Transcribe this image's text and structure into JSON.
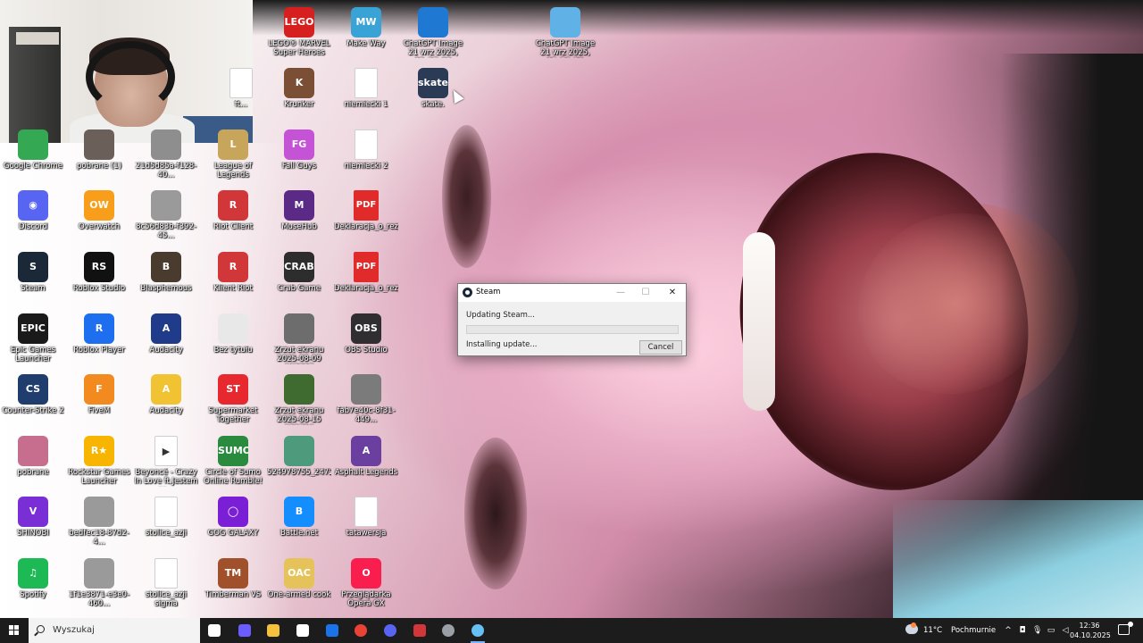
{
  "desktop": {
    "icons": [
      {
        "label": "LEGO® MARVEL Super Heroes",
        "glyph": "LEGO",
        "color": "#d6201f"
      },
      {
        "label": "Make Way",
        "glyph": "MW",
        "color": "#3aa3d6"
      },
      {
        "label": "ChatGPT Image 21 wrz 2025, 02_27_03",
        "glyph": "",
        "color": "#1f78d1"
      },
      {
        "label": "ChatGPT Image 21 wrz 2025, 05_56_20",
        "glyph": "",
        "color": "#5fb1e6"
      },
      {
        "label": "Krunker",
        "glyph": "K",
        "color": "#7a4f36"
      },
      {
        "label": "niemiecki 1",
        "glyph": "",
        "color": "#ffffff"
      },
      {
        "label": "skate.",
        "glyph": "skate",
        "color": "#2b3a55"
      },
      {
        "label": "Google Chrome",
        "glyph": "",
        "color": "#34a853"
      },
      {
        "label": "pobrane (1)",
        "glyph": "",
        "color": "#6b5f5a"
      },
      {
        "label": "21d5d85a-f128-40...",
        "glyph": "",
        "color": "#8e8e8e"
      },
      {
        "label": "League of Legends",
        "glyph": "L",
        "color": "#c7a55a"
      },
      {
        "label": "Fall Guys",
        "glyph": "FG",
        "color": "#c553d6"
      },
      {
        "label": "niemiecki 2",
        "glyph": "",
        "color": "#ffffff"
      },
      {
        "label": "Discord",
        "glyph": "◉",
        "color": "#5865f2"
      },
      {
        "label": "Overwatch",
        "glyph": "OW",
        "color": "#f99e1a"
      },
      {
        "label": "8c56d83b-f392-45...",
        "glyph": "",
        "color": "#9a9a9a"
      },
      {
        "label": "Riot Client",
        "glyph": "R",
        "color": "#d13639"
      },
      {
        "label": "MuseHub",
        "glyph": "M",
        "color": "#5b2a86"
      },
      {
        "label": "Deklaracja_o_rezy...",
        "glyph": "PDF",
        "color": "#e12b2b"
      },
      {
        "label": "Steam",
        "glyph": "S",
        "color": "#1b2838"
      },
      {
        "label": "Roblox Studio",
        "glyph": "RS",
        "color": "#111111"
      },
      {
        "label": "Blasphemous",
        "glyph": "B",
        "color": "#4a3b2f"
      },
      {
        "label": "Klient Riot",
        "glyph": "R",
        "color": "#d13639"
      },
      {
        "label": "Crab Game",
        "glyph": "CRAB",
        "color": "#2d2d2d"
      },
      {
        "label": "Deklaracja_o_rezy...",
        "glyph": "PDF",
        "color": "#e12b2b"
      },
      {
        "label": "Epic Games Launcher",
        "glyph": "EPIC",
        "color": "#1a1a1a"
      },
      {
        "label": "Roblox Player",
        "glyph": "R",
        "color": "#1e6ef0"
      },
      {
        "label": "Audacity",
        "glyph": "A",
        "color": "#1f3b8a"
      },
      {
        "label": "Bez tytułu",
        "glyph": "",
        "color": "#e8e8e8"
      },
      {
        "label": "Zrzut ekranu 2025-08-09 163327",
        "glyph": "",
        "color": "#6d6d6d"
      },
      {
        "label": "OBS Studio",
        "glyph": "OBS",
        "color": "#302e31"
      },
      {
        "label": "Counter-Strike 2",
        "glyph": "CS",
        "color": "#1f3d6d"
      },
      {
        "label": "FiveM",
        "glyph": "F",
        "color": "#f28a1f"
      },
      {
        "label": "Audacity",
        "glyph": "A",
        "color": "#f1c232"
      },
      {
        "label": "Supermarket Together",
        "glyph": "ST",
        "color": "#e8282f"
      },
      {
        "label": "Zrzut ekranu 2025-08-15 121724",
        "glyph": "",
        "color": "#3f6b31"
      },
      {
        "label": "fab7e40c-8f31-449...",
        "glyph": "",
        "color": "#7b7b7b"
      },
      {
        "label": "pobrane",
        "glyph": "",
        "color": "#c76d8e"
      },
      {
        "label": "Rockstar Games Launcher",
        "glyph": "R★",
        "color": "#f7b500"
      },
      {
        "label": "Beyoncé - Crazy In Love ft.Jestem go...",
        "glyph": "▶",
        "color": "#ffffff"
      },
      {
        "label": "Circle of Sumo Online Rumble!",
        "glyph": "SUMO",
        "color": "#2a8a3e"
      },
      {
        "label": "524978755_247212...",
        "glyph": "",
        "color": "#4e9a7c"
      },
      {
        "label": "Asphalt Legends",
        "glyph": "A",
        "color": "#6b3fa0"
      },
      {
        "label": "SHINOBI",
        "glyph": "V",
        "color": "#7a2ed6"
      },
      {
        "label": "bedfec18-87d2-4...",
        "glyph": "",
        "color": "#9a9a9a"
      },
      {
        "label": "stolice_azji",
        "glyph": "",
        "color": "#ffffff"
      },
      {
        "label": "GOG GALAXY",
        "glyph": "◯",
        "color": "#7b1fd6"
      },
      {
        "label": "Battle.net",
        "glyph": "B",
        "color": "#148eff"
      },
      {
        "label": "tatawersja",
        "glyph": "",
        "color": "#ffffff"
      },
      {
        "label": "Spotify",
        "glyph": "♫",
        "color": "#1db954"
      },
      {
        "label": "1f1e3871-e3e0-460...",
        "glyph": "",
        "color": "#9a9a9a"
      },
      {
        "label": "stolice_azji sigma",
        "glyph": "",
        "color": "#ffffff"
      },
      {
        "label": "Timberman VS",
        "glyph": "TM",
        "color": "#a0502a"
      },
      {
        "label": "One-armed cook",
        "glyph": "OAC",
        "color": "#e6c35a"
      },
      {
        "label": "Przeglądarka Opera GX",
        "glyph": "O",
        "color": "#fa1e4e"
      },
      {
        "label": "ft...",
        "glyph": "",
        "color": "#ffffff"
      }
    ]
  },
  "steam_dialog": {
    "title": "Steam",
    "status": "Updating Steam...",
    "substatus": "Installing update...",
    "progress": 0.0,
    "cancel_label": "Cancel",
    "minimize": "—",
    "maximize": "☐",
    "close": "✕"
  },
  "taskbar": {
    "search_placeholder": "Wyszukaj",
    "apps": [
      {
        "name": "task-view",
        "color": "#ffffff"
      },
      {
        "name": "copilot",
        "color": "#6a5cff"
      },
      {
        "name": "file-explorer",
        "color": "#f3c13a"
      },
      {
        "name": "store",
        "color": "#ffffff"
      },
      {
        "name": "outlook",
        "color": "#1a73e8"
      },
      {
        "name": "chrome",
        "color": "#ea4335"
      },
      {
        "name": "discord",
        "color": "#5865f2"
      },
      {
        "name": "riot",
        "color": "#d13639"
      },
      {
        "name": "obs",
        "color": "#9aa0a6"
      },
      {
        "name": "steam",
        "color": "#66c0f4"
      }
    ],
    "weather": {
      "temp": "11°C",
      "desc": "Pochmurnie"
    },
    "clock": {
      "time": "12:36",
      "date": "04.10.2025"
    }
  }
}
